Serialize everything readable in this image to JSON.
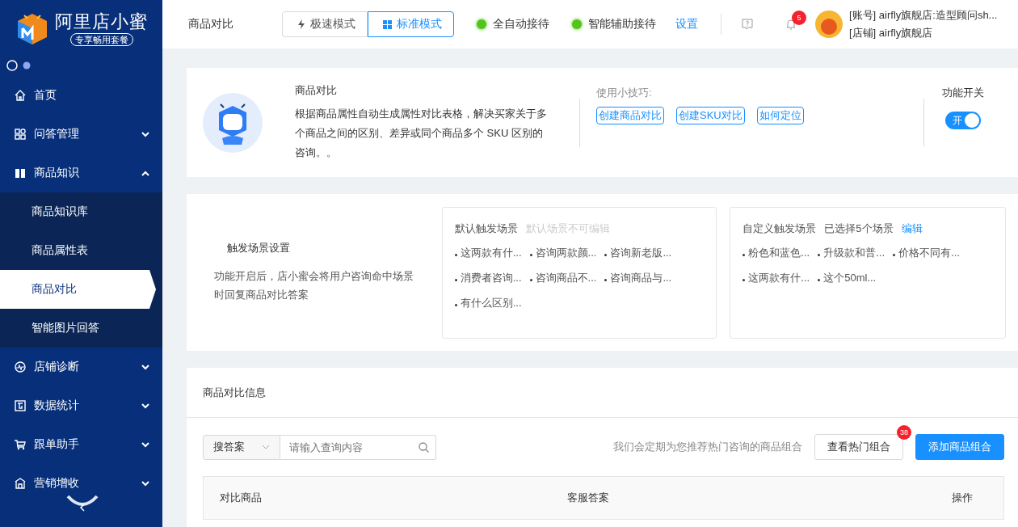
{
  "sidebar": {
    "logo": {
      "title": "阿里店小蜜",
      "badge": "专享畅用套餐"
    },
    "menu": [
      {
        "label": "首页",
        "kind": "link"
      },
      {
        "label": "问答管理",
        "kind": "group",
        "expanded": false
      },
      {
        "label": "商品知识",
        "kind": "group",
        "expanded": true,
        "children": [
          {
            "label": "商品知识库",
            "selected": false
          },
          {
            "label": "商品属性表",
            "selected": false
          },
          {
            "label": "商品对比",
            "selected": true
          },
          {
            "label": "智能图片回答",
            "selected": false
          }
        ]
      },
      {
        "label": "店铺诊断",
        "kind": "group",
        "expanded": false
      },
      {
        "label": "数据统计",
        "kind": "group",
        "expanded": false
      },
      {
        "label": "跟单助手",
        "kind": "group",
        "expanded": false
      },
      {
        "label": "营销增收",
        "kind": "group",
        "expanded": false
      }
    ]
  },
  "topbar": {
    "page_title": "商品对比",
    "modes": [
      {
        "label": "极速模式",
        "selected": false
      },
      {
        "label": "标准模式",
        "selected": true
      }
    ],
    "statuses": [
      {
        "label": "全自动接待",
        "on": true
      },
      {
        "label": "智能辅助接待",
        "on": true
      }
    ],
    "settings_link": "设置",
    "notification_count": "5",
    "account": {
      "line_1": "[账号] airfly旗舰店:造型顾问sh...",
      "line_2": "[店铺] airfly旗舰店"
    }
  },
  "intro": {
    "title": "商品对比",
    "description": "根据商品属性自动生成属性对比表格，解决买家关于多个商品之间的区别、差异或同个商品多个 SKU 区别的咨询。。",
    "tips_label": "使用小技巧:",
    "tips": [
      "创建商品对比",
      "创建SKU对比",
      "如何定位"
    ],
    "switch_label": "功能开关",
    "switch": {
      "on": true,
      "label": "开"
    }
  },
  "trigger": {
    "title": "触发场景设置",
    "description": "功能开启后，店小蜜会将用户咨询命中场景时回复商品对比答案",
    "default": {
      "title": "默认触发场景",
      "note": "默认场景不可编辑",
      "items": [
        "这两款有什...",
        "咨询两款颜...",
        "咨询新老版...",
        "消费者咨询...",
        "咨询商品不...",
        "咨询商品与...",
        "有什么区别..."
      ]
    },
    "custom": {
      "title": "自定义触发场景",
      "note": "已选择5个场景",
      "edit_link": "编辑",
      "items": [
        "粉色和蓝色...",
        "升级款和普...",
        "价格不同有...",
        "这两款有什...",
        "这个50ml..."
      ]
    }
  },
  "comparison": {
    "title": "商品对比信息",
    "search": {
      "type": "搜答案",
      "placeholder": "请输入查询内容"
    },
    "hint": "我们会定期为您推荐热门咨询的商品组合",
    "hot_button": "查看热门组合",
    "hot_count": "38",
    "add_button": "添加商品组合",
    "table": {
      "columns": [
        "对比商品",
        "客服答案",
        "操作"
      ]
    }
  }
}
